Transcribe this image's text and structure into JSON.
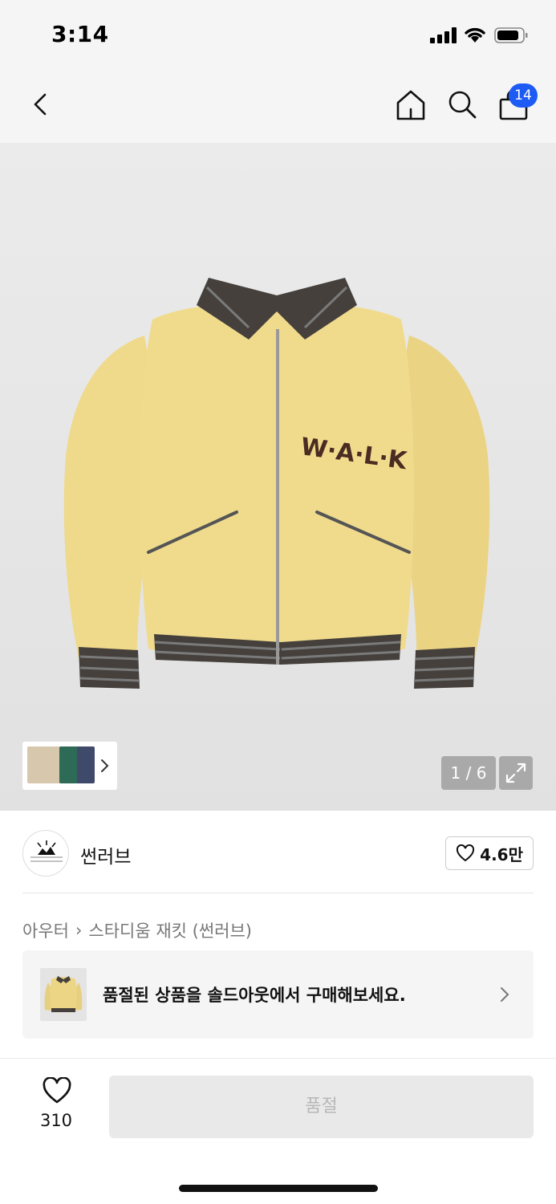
{
  "status_bar": {
    "time": "3:14"
  },
  "top_nav": {
    "cart_count": "14"
  },
  "gallery": {
    "counter": "1 / 6"
  },
  "brand": {
    "name": "썬러브",
    "likes": "4.6만"
  },
  "breadcrumb": {
    "category": "아우터",
    "separator": "›",
    "product": "스타디움 재킷 (썬러브)"
  },
  "soldout_banner": {
    "text": "품절된 상품을 솔드아웃에서 구매해보세요."
  },
  "bottom_bar": {
    "wish_count": "310",
    "buy_label": "품절"
  },
  "colors": {
    "accent": "#1e5bf5",
    "jacket": "#efd98a",
    "rib": "#45403c"
  }
}
